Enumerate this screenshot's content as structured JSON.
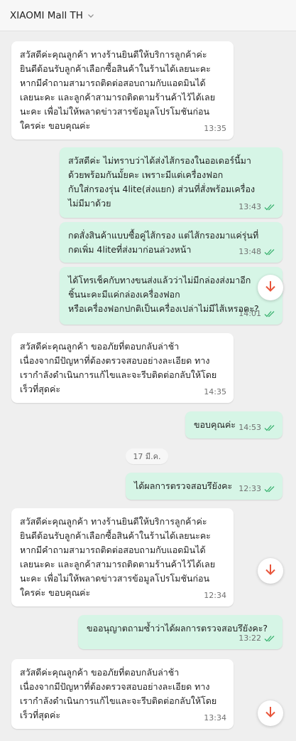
{
  "header": {
    "title": "XIAOMI Mall TH",
    "chevron_icon": "chevron-down-icon"
  },
  "messages": [
    {
      "direction": "in",
      "text": "สวัสดีค่ะคุณลูกค้า ทางร้านยินดีให้บริการลูกค้าค่ะ\nยินดีต้อนรับลูกค้าเลือกซื้อสินค้าในร้านได้เลยนะคะ\nหากมีคำถามสามารถติดต่อสอบถามกับแอดมินได้\nเลยนะคะ และลูกค้าสามารถติดตามร้านค้าไว้ได้เลย\nนะคะ เพื่อไม่ให้พลาดข่าวสารข้อมูลโปรโมชันก่อน\nใครค่ะ ขอบคุณค่ะ",
      "time": "13:35"
    },
    {
      "direction": "out",
      "text": "สวัสดีค่ะ ไม่ทราบว่าได้ส่งไส้กรองในออเดอร์นี้มา\nด้วยพร้อมกันมั้ยคะ เพราะมีแต่เครื่องฟอก\nกับใส่กรองรุ่น 4lite(ส่งแยก) ส่วนที่สั่งพร้อมเครื่อง\nไม่มีมาด้วย",
      "time": "13:43"
    },
    {
      "direction": "out",
      "text": "กดสั่งสินค้าแบบซื้อคู่ไส้กรอง แต่ไส้กรองมาแค่รุ่นที่\nกดเพิ่ม 4liteที่ส่งมาก่อนล่วงหน้า",
      "time": "13:48"
    },
    {
      "direction": "out",
      "text": "ได้โทรเช็คกับทางขนส่งแล้วว่าไม่มีกล่องส่งมาอีก\nชิ้นนะคะมีแค่กล่องเครื่องฟอก\nหรือเครื่องฟอกปกติเป็นเครื่องเปล่าไม่มีไส้เหรอคะ?",
      "time": "14:01"
    },
    {
      "direction": "in",
      "text": "สวัสดีค่ะคุณลูกค้า ขออภัยที่ตอบกลับล่าช้า\nเนื่องจากมีปัญหาที่ต้องตรวจสอบอย่างละเอียด ทาง\nเรากำลังดำเนินการแก้ไขและจะรีบติดต่อกลับให้โดย\nเร็วที่สุดค่ะ",
      "time": "14:35"
    },
    {
      "direction": "out",
      "text": "ขอบคุณค่ะ",
      "time": "14:53"
    },
    {
      "direction": "out",
      "text": "ได้ผลการตรวจสอบรึยังคะ",
      "time": "12:33"
    },
    {
      "direction": "in",
      "text": "สวัสดีค่ะคุณลูกค้า ทางร้านยินดีให้บริการลูกค้าค่ะ\nยินดีต้อนรับลูกค้าเลือกซื้อสินค้าในร้านได้เลยนะคะ\nหากมีคำถามสามารถติดต่อสอบถามกับแอดมินได้\nเลยนะคะ และลูกค้าสามารถติดตามร้านค้าไว้ได้เลย\nนะคะ เพื่อไม่ให้พลาดข่าวสารข้อมูลโปรโมชันก่อน\nใครค่ะ ขอบคุณค่ะ",
      "time": "12:34"
    },
    {
      "direction": "out",
      "text": "ขออนุญาตถามซ้ำว่าได้ผลการตรวจสอบรึยังคะ?",
      "time": "13:22"
    },
    {
      "direction": "in",
      "text": "สวัสดีค่ะคุณลูกค้า ขออภัยที่ตอบกลับล่าช้า\nเนื่องจากมีปัญหาที่ต้องตรวจสอบอย่างละเอียด ทาง\nเรากำลังดำเนินการแก้ไขและจะรีบติดต่อกลับให้โดย\nเร็วที่สุดค่ะ",
      "time": "13:34"
    }
  ],
  "date_separator": "17 มี.ค.",
  "colors": {
    "incoming_bubble": "#ffffff",
    "outgoing_bubble": "#d6f5e6",
    "read_tick": "#3cb371",
    "scroll_arrow": "#e8543a",
    "background": "#efefef"
  },
  "icons": {
    "read_receipt": "double-check-icon",
    "scroll_down": "arrow-down-icon"
  }
}
